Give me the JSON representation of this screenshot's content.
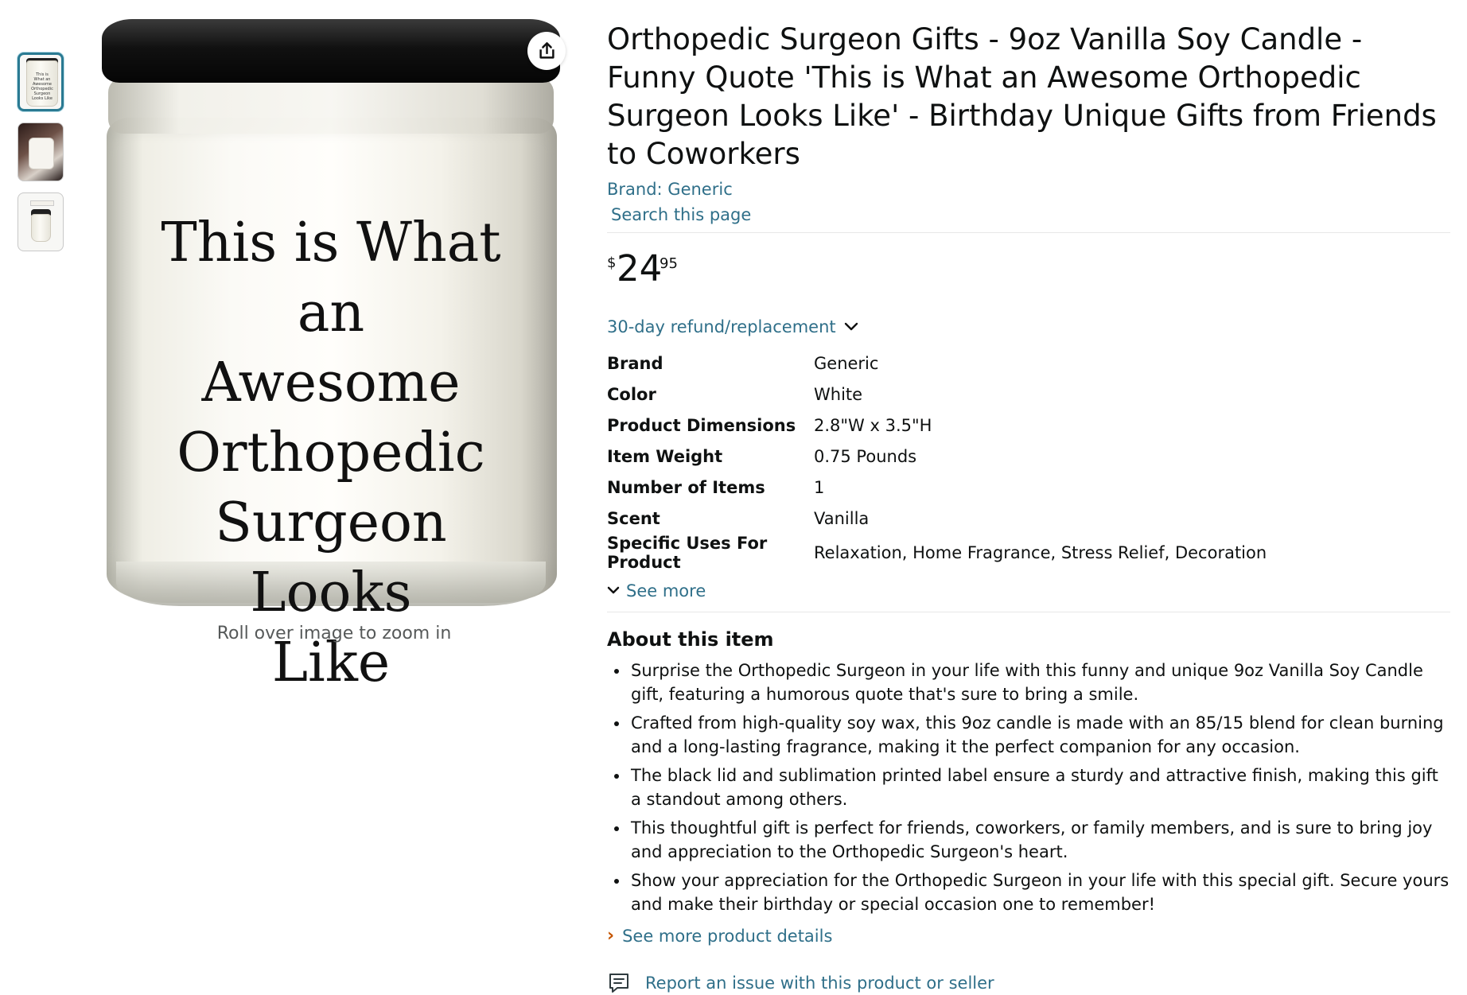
{
  "main_image": {
    "jar_text": [
      "This is What an",
      "Awesome",
      "Orthopedic",
      "Surgeon Looks",
      "Like"
    ],
    "rollover_text": "Roll over image to zoom in"
  },
  "thumbnails": [
    {
      "label": "candle-front-thumbnail",
      "mini_text": "This is What an Awesome Orthopedic Surgeon Looks Like"
    },
    {
      "label": "lifestyle-thumbnail"
    },
    {
      "label": "product-detail-thumbnail"
    }
  ],
  "product": {
    "title": "Orthopedic Surgeon Gifts - 9oz Vanilla Soy Candle - Funny Quote 'This is What an Awesome Orthopedic Surgeon Looks Like' - Birthday Unique Gifts from Friends to Coworkers",
    "brand_link": "Brand: Generic",
    "search_page": "Search this page",
    "price": {
      "currency": "$",
      "whole": "24",
      "fraction": "95"
    },
    "returns": "30-day refund/replacement",
    "specs": [
      {
        "label": "Brand",
        "value": "Generic"
      },
      {
        "label": "Color",
        "value": "White"
      },
      {
        "label": "Product Dimensions",
        "value": "2.8\"W x 3.5\"H"
      },
      {
        "label": "Item Weight",
        "value": "0.75 Pounds"
      },
      {
        "label": "Number of Items",
        "value": "1"
      },
      {
        "label": "Scent",
        "value": "Vanilla"
      },
      {
        "label": "Specific Uses For Product",
        "value": "Relaxation, Home Fragrance, Stress Relief, Decoration"
      }
    ],
    "see_more": "See more",
    "about_title": "About this item",
    "bullets": [
      "Surprise the Orthopedic Surgeon in your life with this funny and unique 9oz Vanilla Soy Candle gift, featuring a humorous quote that's sure to bring a smile.",
      "Crafted from high-quality soy wax, this 9oz candle is made with an 85/15 blend for clean burning and a long-lasting fragrance, making it the perfect companion for any occasion.",
      "The black lid and sublimation printed label ensure a sturdy and attractive finish, making this gift a standout among others.",
      "This thoughtful gift is perfect for friends, coworkers, or family members, and is sure to bring joy and appreciation to the Orthopedic Surgeon's heart.",
      "Show your appreciation for the Orthopedic Surgeon in your life with this special gift. Secure yours and make their birthday or special occasion one to remember!"
    ],
    "details_link": "See more product details",
    "report_link": "Report an issue with this product or seller"
  },
  "icons": {
    "share": "share-icon",
    "chevron_down": "chevron-down-icon",
    "chevron_right": "chevron-right-icon",
    "report": "report-issue-icon"
  },
  "colors": {
    "link": "#2f6f89",
    "accent": "#c45500",
    "thumbnail_selected": "#2a7a92"
  }
}
